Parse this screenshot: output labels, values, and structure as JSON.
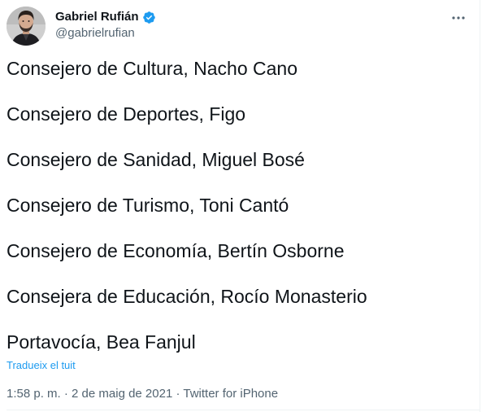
{
  "author": {
    "display_name": "Gabriel Rufián",
    "handle": "@gabrielrufian",
    "verified": true,
    "avatar_icon": "avatar-photo"
  },
  "menu": {
    "icon": "more-dots-icon"
  },
  "tweet": {
    "lines": [
      "Consejero de Cultura, Nacho Cano",
      "Consejero de Deportes, Figo",
      "Consejero de Sanidad, Miguel Bosé",
      "Consejero de Turismo, Toni Cantó",
      "Consejero de Economía, Bertín Osborne",
      "Consejera de Educación, Rocío Monasterio",
      "Portavocía, Bea Fanjul"
    ],
    "translate_label": "Tradueix el tuit",
    "timestamp": "1:58 p. m. · 2 de maig de 2021 · Twitter for iPhone"
  },
  "colors": {
    "text": "#0f1419",
    "secondary": "#536471",
    "accent": "#1d9bf0",
    "verified_badge": "#1d9bf0"
  }
}
